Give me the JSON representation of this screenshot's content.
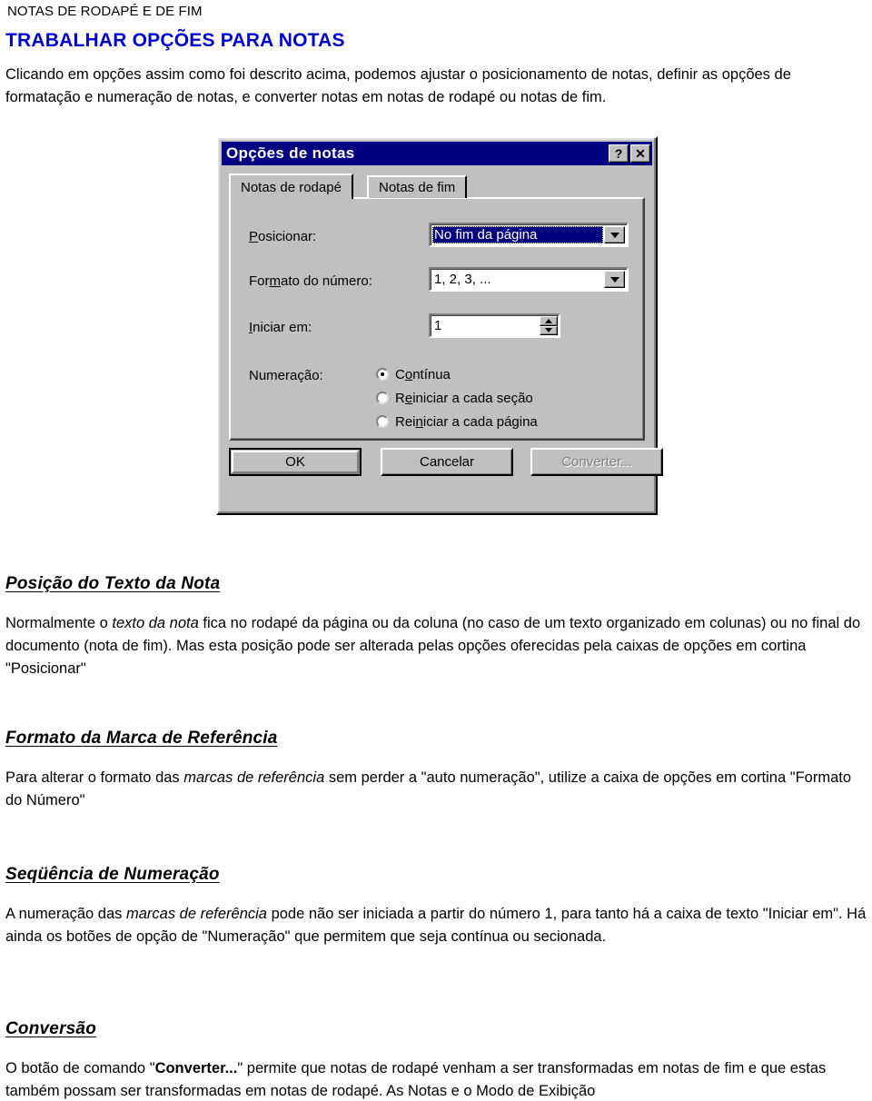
{
  "document": {
    "running_header": "NOTAS DE RODAPÉ E DE FIM",
    "title": "TRABALHAR OPÇÕES PARA NOTAS",
    "title_color": "#0000cc",
    "intro": "Clicando em opções assim como foi descrito acima, podemos ajustar o posicionamento de notas, definir as opções de formatação e numeração de notas, e converter notas em notas de rodapé ou notas de fim."
  },
  "dialog": {
    "title": "Opções de notas",
    "titlebar_color": "#000080",
    "help_button": "?",
    "close_button": "✕",
    "tabs": [
      {
        "label": "Notas de rodapé",
        "active": true
      },
      {
        "label": "Notas de fim",
        "active": false
      }
    ],
    "fields": {
      "posicionar": {
        "label": "Posicionar:",
        "value": "No fim da página",
        "selected": true
      },
      "formato_do_numero": {
        "label": "Formato do número:",
        "value": "1, 2, 3, ..."
      },
      "iniciar_em": {
        "label": "Iniciar em:",
        "value": "1"
      },
      "numeracao": {
        "label": "Numeração:",
        "options": [
          {
            "label": "Contínua",
            "checked": true
          },
          {
            "label": "Reiniciar a cada seção",
            "checked": false
          },
          {
            "label": "Reiniciar a cada página",
            "checked": false
          }
        ]
      }
    },
    "buttons": [
      {
        "label": "OK",
        "style": "default"
      },
      {
        "label": "Cancelar",
        "style": "normal"
      },
      {
        "label": "Converter...",
        "style": "disabled"
      }
    ]
  },
  "sections": [
    {
      "heading": "Posição do Texto da Nota",
      "body_parts": [
        {
          "text": "Normalmente o ",
          "style": "normal"
        },
        {
          "text": "texto da nota",
          "style": "italic"
        },
        {
          "text": " fica no rodapé da página ou da coluna (no caso de um texto organizado em colunas) ou no final do documento (nota de fim). Mas esta posição pode ser alterada pelas opções oferecidas pela caixas de opções em cortina \"Posicionar\"",
          "style": "normal"
        }
      ]
    },
    {
      "heading": "Formato da Marca de Referência",
      "body_parts": [
        {
          "text": "Para alterar o formato das ",
          "style": "normal"
        },
        {
          "text": "marcas de referência",
          "style": "italic"
        },
        {
          "text": " sem perder a \"auto numeração\", utilize a caixa de opções em cortina \"Formato do Número\"",
          "style": "normal"
        }
      ]
    },
    {
      "heading": "Seqüência de Numeração",
      "body_parts": [
        {
          "text": "A numeração das ",
          "style": "normal"
        },
        {
          "text": "marcas de referência",
          "style": "italic"
        },
        {
          "text": " pode não ser iniciada a partir do número 1, para tanto há a caixa de texto \"Iniciar em\". Há ainda os botões de opção de \"Numeração\" que permitem que seja contínua ou secionada.",
          "style": "normal"
        }
      ]
    },
    {
      "heading": "Conversão",
      "body_parts": [
        {
          "text": "O botão de comando \"",
          "style": "normal"
        },
        {
          "text": "Converter...",
          "style": "bold"
        },
        {
          "text": "\" permite que notas de rodapé venham a ser transformadas em notas de fim e que estas também possam ser transformadas em notas de rodapé. As Notas e o Modo de Exibição",
          "style": "normal"
        }
      ]
    }
  ]
}
